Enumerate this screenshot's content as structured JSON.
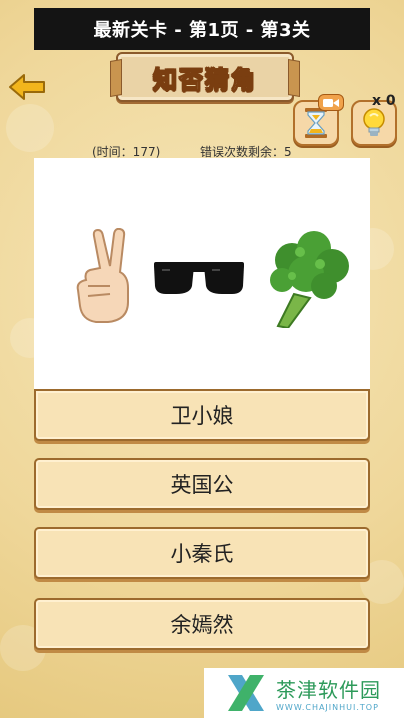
{
  "header": {
    "level_info": "最新关卡 - 第1页 - 第3关"
  },
  "title": "知否猜角",
  "tools": {
    "hint_count": "x 0"
  },
  "status": {
    "time_label": "(时间：177)",
    "errors_label": "错误次数剩余：5"
  },
  "puzzle": {
    "emojis": [
      "victory-hand",
      "sunglasses",
      "broccoli"
    ]
  },
  "answers": [
    {
      "label": "卫小娘"
    },
    {
      "label": "英国公"
    },
    {
      "label": "小秦氏"
    },
    {
      "label": "余嫣然"
    }
  ],
  "watermark": {
    "name": "茶津软件园",
    "url": "WWW.CHAJINHUI.TOP"
  },
  "colors": {
    "answer_bg": "#f8e3b6",
    "answer_border": "#9c6a2d",
    "top_bar": "#141414",
    "background": "#efd79a"
  }
}
